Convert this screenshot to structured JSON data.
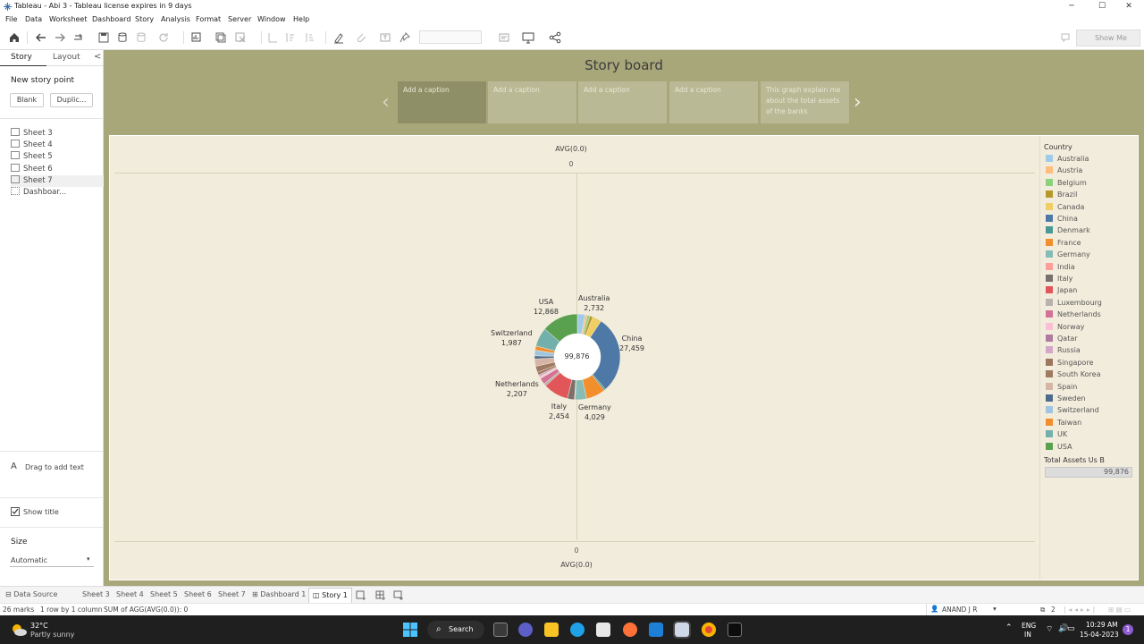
{
  "window": {
    "title": "Tableau - Abi 3 - Tableau license expires in 9 days",
    "minimize": "─",
    "maximize": "☐",
    "close": "✕"
  },
  "menu": [
    "File",
    "Data",
    "Worksheet",
    "Dashboard",
    "Story",
    "Analysis",
    "Format",
    "Server",
    "Window",
    "Help"
  ],
  "toolbar": {
    "show_me": "Show Me"
  },
  "left_panel": {
    "tab_story": "Story",
    "tab_layout": "Layout",
    "collapse": "<",
    "new_story_point": "New story point",
    "blank_button": "Blank",
    "duplicate_button": "Duplic...",
    "sheets": [
      "Sheet 3",
      "Sheet 4",
      "Sheet 5",
      "Sheet 6",
      "Sheet 7",
      "Dashboar..."
    ],
    "drag_text": "Drag to add text",
    "show_title": "Show title",
    "size_label": "Size",
    "size_value": "Automatic"
  },
  "story": {
    "title": "Story board",
    "captions": [
      "Add a caption",
      "Add a caption",
      "Add a caption",
      "Add a caption",
      "This graph explain me about the total assets of the banks"
    ],
    "prev_arrow": "‹",
    "next_arrow": "›"
  },
  "viz": {
    "top_axis_label": "AVG(0.0)",
    "top_axis_tick": "0",
    "bottom_axis_tick": "0",
    "bottom_axis_label": "AVG(0.0)",
    "center_total": "99,876",
    "labels": [
      {
        "country": "USA",
        "value": "12,868"
      },
      {
        "country": "Australia",
        "value": "2,732"
      },
      {
        "country": "Switzerland",
        "value": "1,987"
      },
      {
        "country": "China",
        "value": "27,459"
      },
      {
        "country": "Netherlands",
        "value": "2,207"
      },
      {
        "country": "Italy",
        "value": "2,454"
      },
      {
        "country": "Germany",
        "value": "4,029"
      }
    ]
  },
  "chart_data": {
    "type": "pie",
    "title": "",
    "center_label": "99,876",
    "total": 99876,
    "slices": [
      {
        "name": "Australia",
        "value": 2732,
        "color": "#a0cbe8"
      },
      {
        "name": "Austria",
        "value": 800,
        "color": "#ffbe7d"
      },
      {
        "name": "Belgium",
        "value": 900,
        "color": "#8cd17d"
      },
      {
        "name": "Brazil",
        "value": 1100,
        "color": "#b6992d"
      },
      {
        "name": "Canada",
        "value": 3200,
        "color": "#f1ce63"
      },
      {
        "name": "China",
        "value": 27459,
        "color": "#4e79a7"
      },
      {
        "name": "Denmark",
        "value": 600,
        "color": "#499894"
      },
      {
        "name": "France",
        "value": 6800,
        "color": "#f28e2b"
      },
      {
        "name": "Germany",
        "value": 4029,
        "color": "#86bcb6"
      },
      {
        "name": "India",
        "value": 300,
        "color": "#ff9d9a"
      },
      {
        "name": "Italy",
        "value": 2454,
        "color": "#79706e"
      },
      {
        "name": "Japan",
        "value": 8900,
        "color": "#e15759"
      },
      {
        "name": "Luxembourg",
        "value": 900,
        "color": "#bab0ac"
      },
      {
        "name": "Netherlands",
        "value": 2207,
        "color": "#d37295"
      },
      {
        "name": "Norway",
        "value": 500,
        "color": "#fabfd2"
      },
      {
        "name": "Qatar",
        "value": 200,
        "color": "#b07aa1"
      },
      {
        "name": "Russia",
        "value": 700,
        "color": "#d4a6c8"
      },
      {
        "name": "Singapore",
        "value": 1000,
        "color": "#9d7660"
      },
      {
        "name": "South Korea",
        "value": 2200,
        "color": "#a07a62"
      },
      {
        "name": "Spain",
        "value": 2600,
        "color": "#d7b5a6"
      },
      {
        "name": "Sweden",
        "value": 1100,
        "color": "#4e6b8c"
      },
      {
        "name": "Switzerland",
        "value": 1987,
        "color": "#9fc5e0"
      },
      {
        "name": "Taiwan",
        "value": 1500,
        "color": "#f28e2b"
      },
      {
        "name": "UK",
        "value": 6700,
        "color": "#73b0ac"
      },
      {
        "name": "USA",
        "value": 12868,
        "color": "#59a14f"
      }
    ]
  },
  "legend": {
    "title": "Country",
    "items": [
      {
        "name": "Australia",
        "color": "#a0cbe8"
      },
      {
        "name": "Austria",
        "color": "#ffbe7d"
      },
      {
        "name": "Belgium",
        "color": "#8cd17d"
      },
      {
        "name": "Brazil",
        "color": "#b6992d"
      },
      {
        "name": "Canada",
        "color": "#f1ce63"
      },
      {
        "name": "China",
        "color": "#4e79a7"
      },
      {
        "name": "Denmark",
        "color": "#499894"
      },
      {
        "name": "France",
        "color": "#f28e2b"
      },
      {
        "name": "Germany",
        "color": "#86bcb6"
      },
      {
        "name": "India",
        "color": "#ff9d9a"
      },
      {
        "name": "Italy",
        "color": "#79706e"
      },
      {
        "name": "Japan",
        "color": "#e15759"
      },
      {
        "name": "Luxembourg",
        "color": "#bab0ac"
      },
      {
        "name": "Netherlands",
        "color": "#d37295"
      },
      {
        "name": "Norway",
        "color": "#fabfd2"
      },
      {
        "name": "Qatar",
        "color": "#b07aa1"
      },
      {
        "name": "Russia",
        "color": "#d4a6c8"
      },
      {
        "name": "Singapore",
        "color": "#9d7660"
      },
      {
        "name": "South Korea",
        "color": "#a07a62"
      },
      {
        "name": "Spain",
        "color": "#d7b5a6"
      },
      {
        "name": "Sweden",
        "color": "#4e6b8c"
      },
      {
        "name": "Switzerland",
        "color": "#9fc5e0"
      },
      {
        "name": "Taiwan",
        "color": "#f28e2b"
      },
      {
        "name": "UK",
        "color": "#73b0ac"
      },
      {
        "name": "USA",
        "color": "#59a14f"
      }
    ],
    "total_assets_title": "Total Assets Us B",
    "total_assets_value": "99,876"
  },
  "bottom_tabs": {
    "data_source": "Data Source",
    "tabs": [
      "Sheet 3",
      "Sheet 4",
      "Sheet 5",
      "Sheet 6",
      "Sheet 7",
      "Dashboard 1",
      "Story 1"
    ]
  },
  "status": {
    "marks": "26 marks",
    "rows": "1 row by 1 column",
    "sum": "SUM of AGG(AVG(0.0)): 0",
    "user": "ANAND J R",
    "pages": "2"
  },
  "taskbar": {
    "temp": "32°C",
    "weather": "Partly sunny",
    "search": "Search",
    "lang1": "ENG",
    "lang2": "IN",
    "time": "10:29 AM",
    "date": "15-04-2023"
  }
}
